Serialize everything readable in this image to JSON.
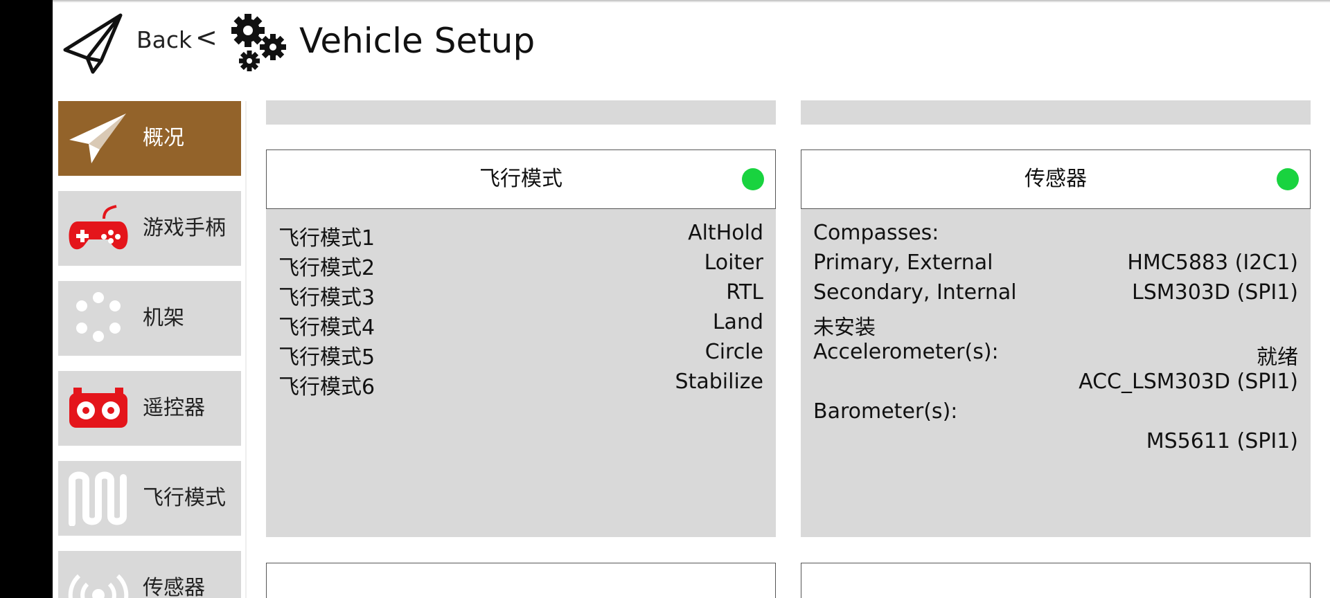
{
  "header": {
    "back_label": "Back",
    "separator": "<",
    "title": "Vehicle Setup"
  },
  "sidebar": {
    "items": [
      {
        "label": "概况",
        "icon": "plane-icon",
        "active": true
      },
      {
        "label": "游戏手柄",
        "icon": "gamepad-icon",
        "active": false
      },
      {
        "label": "机架",
        "icon": "frame-icon",
        "active": false
      },
      {
        "label": "遥控器",
        "icon": "remote-control-icon",
        "active": false
      },
      {
        "label": "飞行模式",
        "icon": "flight-mode-icon",
        "active": false
      },
      {
        "label": "传感器",
        "icon": "sensor-icon",
        "active": false
      }
    ]
  },
  "panels": {
    "flight_modes": {
      "title": "飞行模式",
      "status_color": "#19d33f",
      "rows": [
        {
          "key": "飞行模式1",
          "value": "AltHold"
        },
        {
          "key": "飞行模式2",
          "value": "Loiter"
        },
        {
          "key": "飞行模式3",
          "value": "RTL"
        },
        {
          "key": "飞行模式4",
          "value": "Land"
        },
        {
          "key": "飞行模式5",
          "value": "Circle"
        },
        {
          "key": "飞行模式6",
          "value": "Stabilize"
        }
      ]
    },
    "sensors": {
      "title": "传感器",
      "status_color": "#19d33f",
      "rows": [
        {
          "key": "Compasses:",
          "value": ""
        },
        {
          "key": "Primary, External",
          "value": "HMC5883 (I2C1)"
        },
        {
          "key": "Secondary, Internal",
          "value": "LSM303D (SPI1)"
        },
        {
          "key": "未安装",
          "value": ""
        },
        {
          "key": "Accelerometer(s):",
          "value": "就绪"
        },
        {
          "key": "",
          "value": "ACC_LSM303D (SPI1)"
        },
        {
          "key": "Barometer(s):",
          "value": ""
        },
        {
          "key": "",
          "value": "MS5611 (SPI1)"
        }
      ]
    }
  },
  "colors": {
    "accent": "#93632a",
    "panel_bg": "#d9d9d9",
    "status_ok": "#19d33f",
    "icon_red": "#e4151b"
  }
}
